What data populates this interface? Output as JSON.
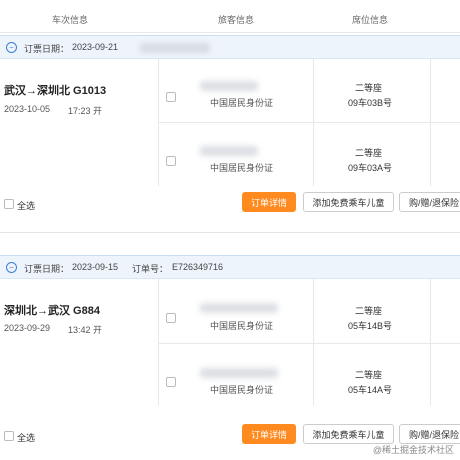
{
  "header": {
    "col_train": "车次信息",
    "col_passenger": "旅客信息",
    "col_seat": "席位信息"
  },
  "orders": [
    {
      "booking_date_label": "订票日期：",
      "booking_date": "2023-09-21",
      "order_no_label": "",
      "order_no": "",
      "route": "武汉→深圳北 G1013",
      "date": "2023-10-05",
      "time": "17:23 开",
      "passengers": [
        {
          "id_type": "中国居民身份证",
          "seat_class": "二等座",
          "seat_no": "09车03B号"
        },
        {
          "id_type": "中国居民身份证",
          "seat_class": "二等座",
          "seat_no": "09车03A号"
        }
      ],
      "select_all": "全选",
      "btn_detail": "订单详情",
      "btn_child": "添加免费乘车儿童",
      "btn_ops": "购/赠/退保险"
    },
    {
      "booking_date_label": "订票日期：",
      "booking_date": "2023-09-15",
      "order_no_label": "订单号：",
      "order_no": "E726349716",
      "route": "深圳北→武汉 G884",
      "date": "2023-09-29",
      "time": "13:42 开",
      "passengers": [
        {
          "id_type": "中国居民身份证",
          "seat_class": "二等座",
          "seat_no": "05车14B号"
        },
        {
          "id_type": "中国居民身份证",
          "seat_class": "二等座",
          "seat_no": "05车14A号"
        }
      ],
      "select_all": "全选",
      "btn_detail": "订单详情",
      "btn_child": "添加免费乘车儿童",
      "btn_ops": "购/赠/退保险"
    }
  ],
  "watermark": "@稀土掘金技术社区",
  "colors": {
    "accent": "#ff8a1f",
    "bar_bg": "#eef4fc",
    "link_blue": "#3b7fd6"
  }
}
